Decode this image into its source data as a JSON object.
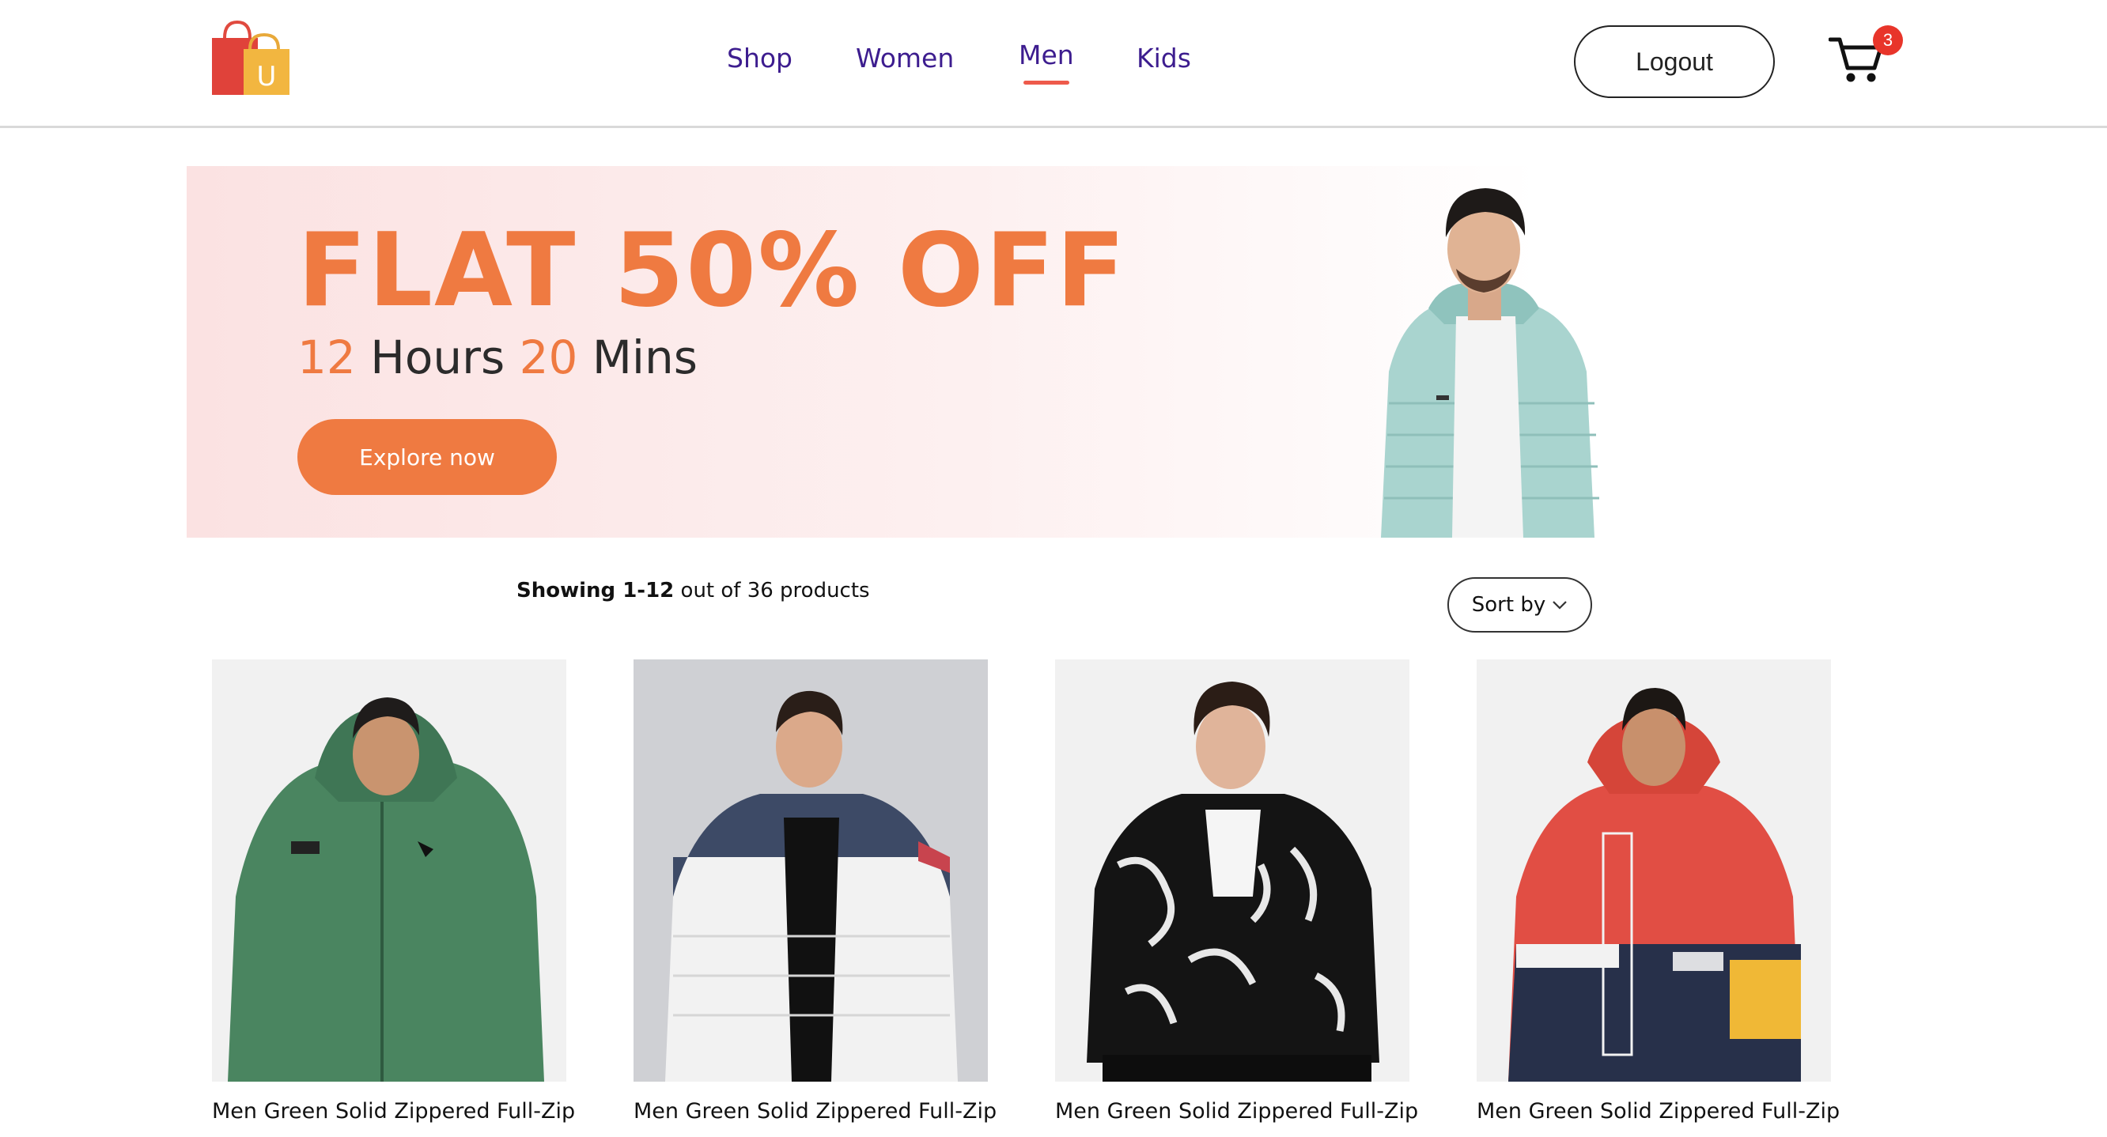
{
  "header": {
    "logo_letter": "U",
    "nav": [
      {
        "label": "Shop",
        "active": false
      },
      {
        "label": "Women",
        "active": false
      },
      {
        "label": "Men",
        "active": true
      },
      {
        "label": "Kids",
        "active": false
      }
    ],
    "logout_label": "Logout",
    "cart_count": "3"
  },
  "banner": {
    "headline": "FLAT 50% OFF",
    "timer_hours": "12",
    "timer_hours_label": "Hours",
    "timer_mins": "20",
    "timer_mins_label": "Mins",
    "cta_label": "Explore now"
  },
  "results": {
    "showing_bold": "Showing 1-12",
    "showing_rest": "out of 36 products",
    "sort_label": "Sort by"
  },
  "products": [
    {
      "name": "Men Green Solid Zippered Full-Zip",
      "image": "green-hooded-jacket"
    },
    {
      "name": "Men Green Solid Zippered Full-Zip",
      "image": "white-navy-puffer-jacket"
    },
    {
      "name": "Men Green Solid Zippered Full-Zip",
      "image": "black-marble-print-bomber"
    },
    {
      "name": "Men Green Solid Zippered Full-Zip",
      "image": "red-navy-urban-street-jacket"
    }
  ],
  "colors": {
    "nav_text": "#3d1d8f",
    "accent_orange": "#ef7a41",
    "active_underline": "#ee5a4b",
    "badge_red": "#e8352a",
    "banner_pink": "#fbe2e2"
  }
}
